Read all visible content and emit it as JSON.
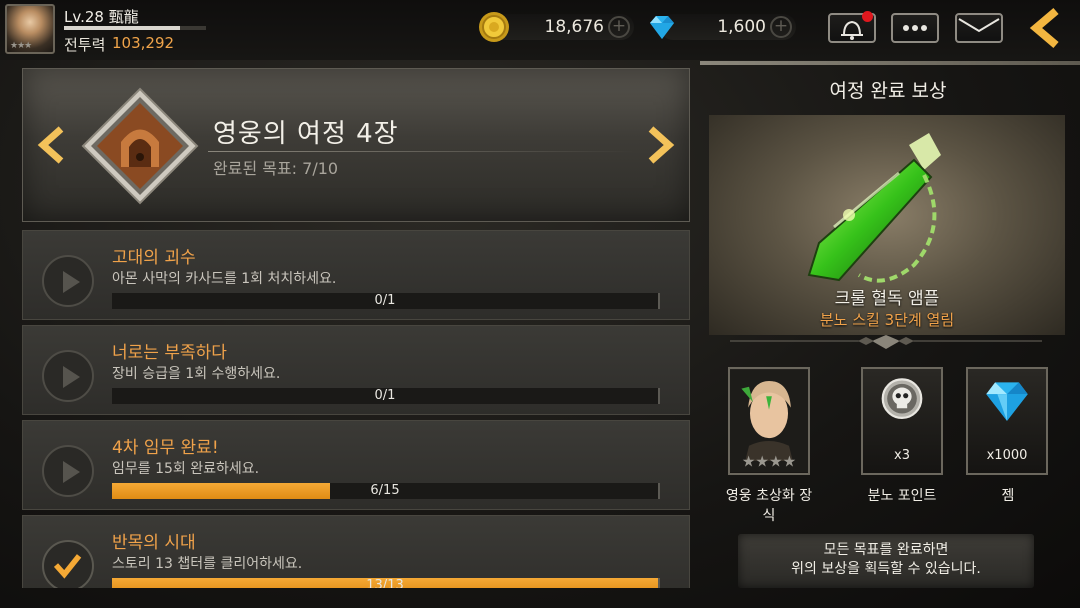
{
  "player": {
    "level": "Lv.28",
    "name": "甄龍",
    "power_label": "전투력",
    "power_value": "103,292",
    "portrait_stars": "★★★"
  },
  "currency": {
    "gold": "18,676",
    "gems": "1,600",
    "plus": "+"
  },
  "top_buttons": [
    "alarm-bell-icon",
    "more-options-icon",
    "mail-icon",
    "back-arrow-icon"
  ],
  "chapter": {
    "title": "영웅의 여정 4장",
    "progress_label": "완료된 목표: 7/10"
  },
  "quests": [
    {
      "title": "고대의 괴수",
      "desc": "아몬 사막의 카사드를 1회 처치하세요.",
      "progress": "0/1",
      "fraction": 0,
      "status": "play"
    },
    {
      "title": "너로는 부족하다",
      "desc": "장비 승급을 1회 수행하세요.",
      "progress": "0/1",
      "fraction": 0,
      "status": "play"
    },
    {
      "title": "4차 임무 완료!",
      "desc": "임무를 15회 완료하세요.",
      "progress": "6/15",
      "fraction": 0.4,
      "status": "play"
    },
    {
      "title": "반목의 시대",
      "desc": "스토리 13 챕터를 클리어하세요.",
      "progress": "13/13",
      "fraction": 1,
      "status": "done"
    }
  ],
  "reward": {
    "header": "여정 완료 보상",
    "main_name": "크룰 혈독 앰플",
    "main_desc": "분노 스킬 3단계 열림",
    "items": [
      {
        "label": "영웅 초상화 장식",
        "count": "",
        "icon": "hero-portrait-icon"
      },
      {
        "label": "분노 포인트",
        "count": "x3",
        "icon": "skull-coin-icon"
      },
      {
        "label": "젬",
        "count": "x1000",
        "icon": "gem-icon"
      }
    ],
    "notice_line1": "모든 목표를 완료하면",
    "notice_line2": "위의 보상을 획득할 수 있습니다."
  },
  "colors": {
    "accent_orange": "#f0a24a",
    "progress_fill": "#f5a935",
    "badge_red": "#e0181e",
    "gem_blue": "#2bb3ee"
  }
}
